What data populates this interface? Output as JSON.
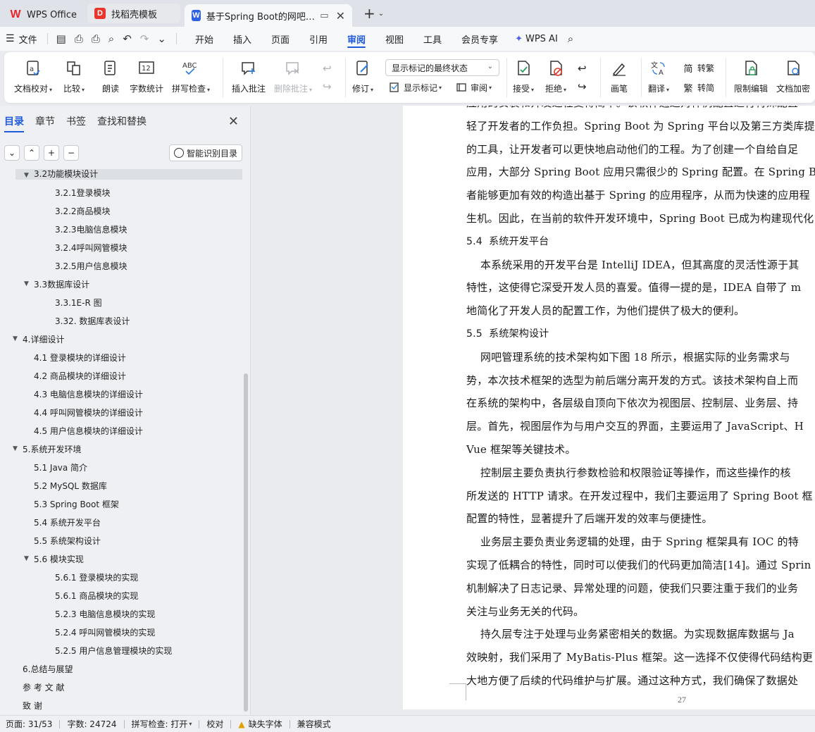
{
  "tabs": {
    "wps_office": "WPS Office",
    "template": "找稻壳模板",
    "document": "基于Spring Boot的网吧管理系统"
  },
  "menu": {
    "file": "文件",
    "tabs": [
      "开始",
      "插入",
      "页面",
      "引用",
      "审阅",
      "视图",
      "工具",
      "会员专享"
    ],
    "active_tab": "审阅",
    "wps_ai": "WPS AI"
  },
  "ribbon": {
    "doc_proof": "文档校对",
    "compare": "比较",
    "read_aloud": "朗读",
    "word_count": "字数统计",
    "spell_check": "拼写检查",
    "insert_comment": "插入批注",
    "delete_comment": "删除批注",
    "track_changes": "修订",
    "markup_state": "显示标记的最终状态",
    "show_markup": "显示标记",
    "review": "审阅",
    "accept": "接受",
    "reject": "拒绝",
    "ink": "画笔",
    "translate": "翻译",
    "to_traditional": "转繁",
    "to_simplified": "转简",
    "restrict_editing": "限制编辑",
    "encrypt": "文档加密"
  },
  "nav": {
    "tabs": [
      "目录",
      "章节",
      "书签",
      "查找和替换"
    ],
    "active_tab": "目录",
    "smart_toc": "智能识别目录",
    "top_partial": "3.2功能模块设计",
    "items": [
      {
        "label": "3.2.1登录模块",
        "level": 3
      },
      {
        "label": "3.2.2商品模块",
        "level": 3
      },
      {
        "label": "3.2.3电脑信息模块",
        "level": 3
      },
      {
        "label": "3.2.4呼叫网管模块",
        "level": 3
      },
      {
        "label": "3.2.5用户信息模块",
        "level": 3
      },
      {
        "label": "3.3数据库设计",
        "level": 2,
        "expanded": true
      },
      {
        "label": "3.3.1E-R 图",
        "level": 3
      },
      {
        "label": "3.32. 数据库表设计",
        "level": 3
      },
      {
        "label": "4.详细设计",
        "level": 1,
        "expanded": true
      },
      {
        "label": "4.1 登录模块的详细设计",
        "level": 2
      },
      {
        "label": "4.2 商品模块的详细设计",
        "level": 2
      },
      {
        "label": "4.3 电脑信息模块的详细设计",
        "level": 2
      },
      {
        "label": "4.4 呼叫网管模块的详细设计",
        "level": 2
      },
      {
        "label": "4.5 用户信息模块的详细设计",
        "level": 2
      },
      {
        "label": "5.系统开发环境",
        "level": 1,
        "expanded": true
      },
      {
        "label": "5.1 Java 简介",
        "level": 2
      },
      {
        "label": "5.2 MySQL 数据库",
        "level": 2
      },
      {
        "label": "5.3 Spring Boot 框架",
        "level": 2
      },
      {
        "label": "5.4 系统开发平台",
        "level": 2
      },
      {
        "label": "5.5 系统架构设计",
        "level": 2
      },
      {
        "label": "5.6 模块实现",
        "level": 2,
        "expanded": true
      },
      {
        "label": "5.6.1 登录模块的实现",
        "level": 3
      },
      {
        "label": "5.6.1 商品模块的实现",
        "level": 3
      },
      {
        "label": "5.2.3 电脑信息模块的实现",
        "level": 3
      },
      {
        "label": "5.2.4 呼叫网管模块的实现",
        "level": 3
      },
      {
        "label": "5.2.5 用户信息管理模块的实现",
        "level": 3
      },
      {
        "label": "6.总结与展望",
        "level": 1
      },
      {
        "label": "参 考 文 献",
        "level": 1
      },
      {
        "label": "致     谢",
        "level": 1
      }
    ]
  },
  "document": {
    "lines": [
      {
        "text": "应用的安装和开发过程变得简单。该软件通过对样例配置进行特殊配置",
        "type": "p"
      },
      {
        "text": "轻了开发者的工作负担。Spring Boot 为 Spring 平台以及第三方类库提供",
        "type": "p"
      },
      {
        "text": "的工具，让开发者可以更快地启动他们的工程。为了创建一个自给自足",
        "type": "p"
      },
      {
        "text": "应用，大部分 Spring Boot 应用只需很少的 Spring 配置。在 Spring Boot",
        "type": "p"
      },
      {
        "text": "者能够更加有效的构造出基于 Spring 的应用程序，从而为快速的应用程",
        "type": "p"
      },
      {
        "text": "生机。因此，在当前的软件开发环境中，Spring Boot 已成为构建现代化",
        "type": "p"
      },
      {
        "text": "5.4  系统开发平台",
        "type": "h"
      },
      {
        "text": "    本系统采用的开发平台是 IntelliJ IDEA，但其高度的灵活性源于其",
        "type": "p"
      },
      {
        "text": "特性，这使得它深受开发人员的喜爱。值得一提的是，IDEA 自带了 m",
        "type": "p"
      },
      {
        "text": "地简化了开发人员的配置工作，为他们提供了极大的便利。",
        "type": "p"
      },
      {
        "text": "5.5  系统架构设计",
        "type": "h"
      },
      {
        "text": "    网吧管理系统的技术架构如下图 18 所示，根据实际的业务需求与",
        "type": "p"
      },
      {
        "text": "势，本次技术框架的选型为前后端分离开发的方式。该技术架构自上而",
        "type": "p"
      },
      {
        "text": "在系统的架构中，各层级自顶向下依次为视图层、控制层、业务层、持",
        "type": "p"
      },
      {
        "text": "层。首先，视图层作为与用户交互的界面，主要运用了 JavaScript、H",
        "type": "p"
      },
      {
        "text": "Vue 框架等关键技术。",
        "type": "p"
      },
      {
        "text": "    控制层主要负责执行参数检验和权限验证等操作，而这些操作的核",
        "type": "p"
      },
      {
        "text": "所发送的 HTTP 请求。在开发过程中，我们主要运用了 Spring Boot 框",
        "type": "p"
      },
      {
        "text": "配置的特性，显著提升了后端开发的效率与便捷性。",
        "type": "p"
      },
      {
        "text": "    业务层主要负责业务逻辑的处理，由于 Spring 框架具有 IOC 的特",
        "type": "p"
      },
      {
        "text": "实现了低耦合的特性，同时可以使我们的代码更加简洁[14]。通过 Sprin",
        "type": "p"
      },
      {
        "text": "机制解决了日志记录、异常处理的问题，使我们只要注重于我们的业务",
        "type": "p"
      },
      {
        "text": "关注与业务无关的代码。",
        "type": "p"
      },
      {
        "text": "    持久层专注于处理与业务紧密相关的数据。为实现数据库数据与 Ja",
        "type": "p"
      },
      {
        "text": "效映射，我们采用了 MyBatis-Plus 框架。这一选择不仅使得代码结构更",
        "type": "p"
      },
      {
        "text": "大地方便了后续的代码维护与扩展。通过这种方式，我们确保了数据处",
        "type": "p"
      }
    ],
    "page_number": "27"
  },
  "status": {
    "page": "页面: 31/53",
    "words": "字数: 24724",
    "spell": "拼写检查: 打开",
    "proof": "校对",
    "missing_font": "缺失字体",
    "compat": "兼容模式"
  }
}
